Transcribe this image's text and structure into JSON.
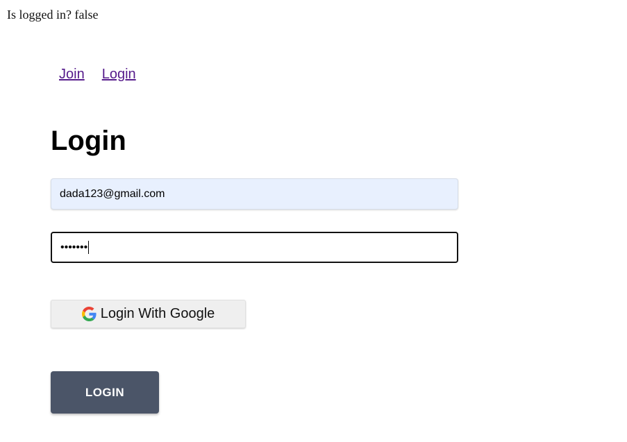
{
  "status": {
    "text": "Is logged in? false"
  },
  "nav": {
    "items": [
      {
        "label": "Join"
      },
      {
        "label": "Login"
      }
    ],
    "link_color": "#551a8b"
  },
  "form": {
    "title": "Login",
    "email": {
      "value": "dada123@gmail.com",
      "background": "#e8f0fe"
    },
    "password": {
      "masked_value": "•••••••"
    },
    "google_button": {
      "label": "Login With Google",
      "icon": "google-g-icon"
    },
    "submit_button": {
      "label": "LOGIN",
      "background": "#4b5568"
    }
  }
}
